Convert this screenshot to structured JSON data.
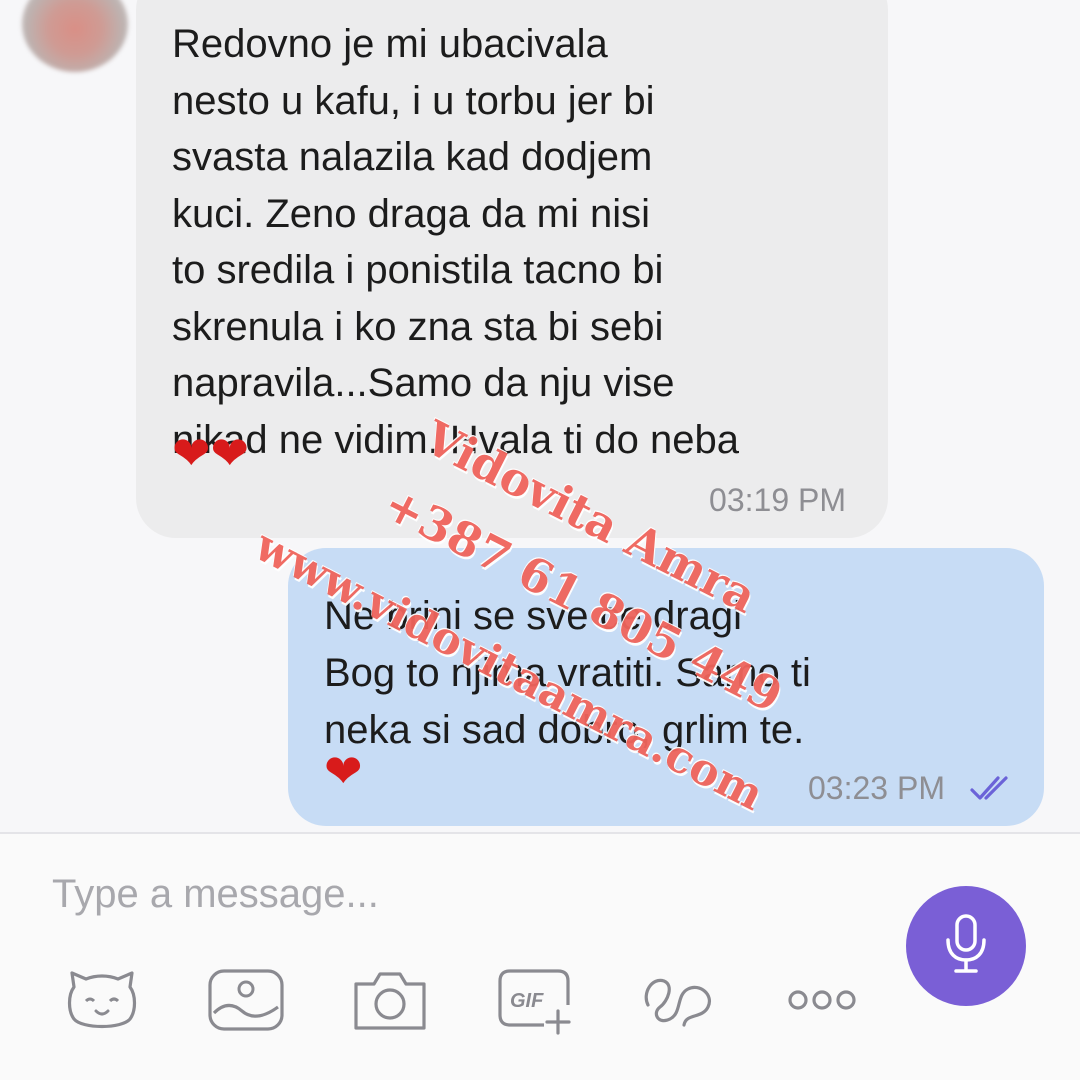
{
  "conversation": {
    "incoming": {
      "lines": [
        "Redovno je mi ubacivala",
        "nesto u kafu, i u torbu jer bi",
        "svasta nalazila kad dodjem",
        "kuci. Zeno draga da mi nisi",
        "to sredila i ponistila tacno bi",
        "skrenula i ko zna sta bi sebi",
        "napravila...Samo da nju vise",
        "nikad ne vidim. Hvala ti do neba"
      ],
      "hearts": "❤❤",
      "time": "03:19 PM"
    },
    "outgoing": {
      "lines": [
        "Ne brini se sve ce dragi",
        "Bog to njima vratiti. Samo ti",
        "neka si sad dobro, grlim te."
      ],
      "hearts": "❤",
      "time": "03:23 PM",
      "status_icon": "double-check-icon"
    }
  },
  "watermark": {
    "name": "Vidovita Amra",
    "phone": "+387 61 805 449",
    "site": "www.vidovitaamra.com"
  },
  "composer": {
    "placeholder": "Type a message...",
    "accent": "#7a5fd6",
    "tools": [
      "sticker-icon",
      "gallery-icon",
      "camera-icon",
      "gif-icon",
      "doodle-icon",
      "more-icon"
    ]
  },
  "colors": {
    "incoming_bubble": "#ececed",
    "outgoing_bubble": "#c7dcf5",
    "heart": "#d81b1b",
    "watermark": "#f0645c"
  }
}
